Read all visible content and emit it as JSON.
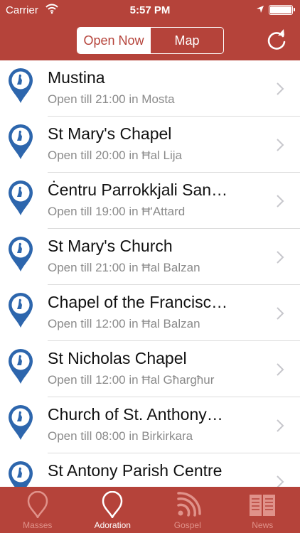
{
  "status_bar": {
    "carrier": "Carrier",
    "time": "5:57 PM"
  },
  "header": {
    "segments": [
      "Open Now",
      "Map"
    ],
    "active_segment": "Open Now"
  },
  "places": [
    {
      "name": "Mustina",
      "detail": "Open till 21:00 in Mosta"
    },
    {
      "name": "St Mary's Chapel",
      "detail": "Open till 20:00 in Ħal Lija"
    },
    {
      "name": "Ċentru Parrokkjali San…",
      "detail": "Open till 19:00 in Ħ'Attard"
    },
    {
      "name": "St Mary's Church",
      "detail": "Open till 21:00 in Ħal Balzan"
    },
    {
      "name": "Chapel of the Francisc…",
      "detail": "Open till 12:00 in Ħal Balzan"
    },
    {
      "name": "St Nicholas Chapel",
      "detail": "Open till 12:00 in Ħal Għargħur"
    },
    {
      "name": "Church of St. Anthony…",
      "detail": "Open till 08:00 in Birkirkara"
    },
    {
      "name": "St Antony Parish Centre",
      "detail": ""
    }
  ],
  "tabs": [
    {
      "label": "Masses",
      "icon": "pin-icon",
      "active": false
    },
    {
      "label": "Adoration",
      "icon": "pin-icon",
      "active": true
    },
    {
      "label": "Gospel",
      "icon": "rss-icon",
      "active": false
    },
    {
      "label": "News",
      "icon": "book-icon",
      "active": false
    }
  ],
  "colors": {
    "brand": "#b5433a",
    "pin": "#2d66ad",
    "tab_inactive": "#e0928a"
  }
}
